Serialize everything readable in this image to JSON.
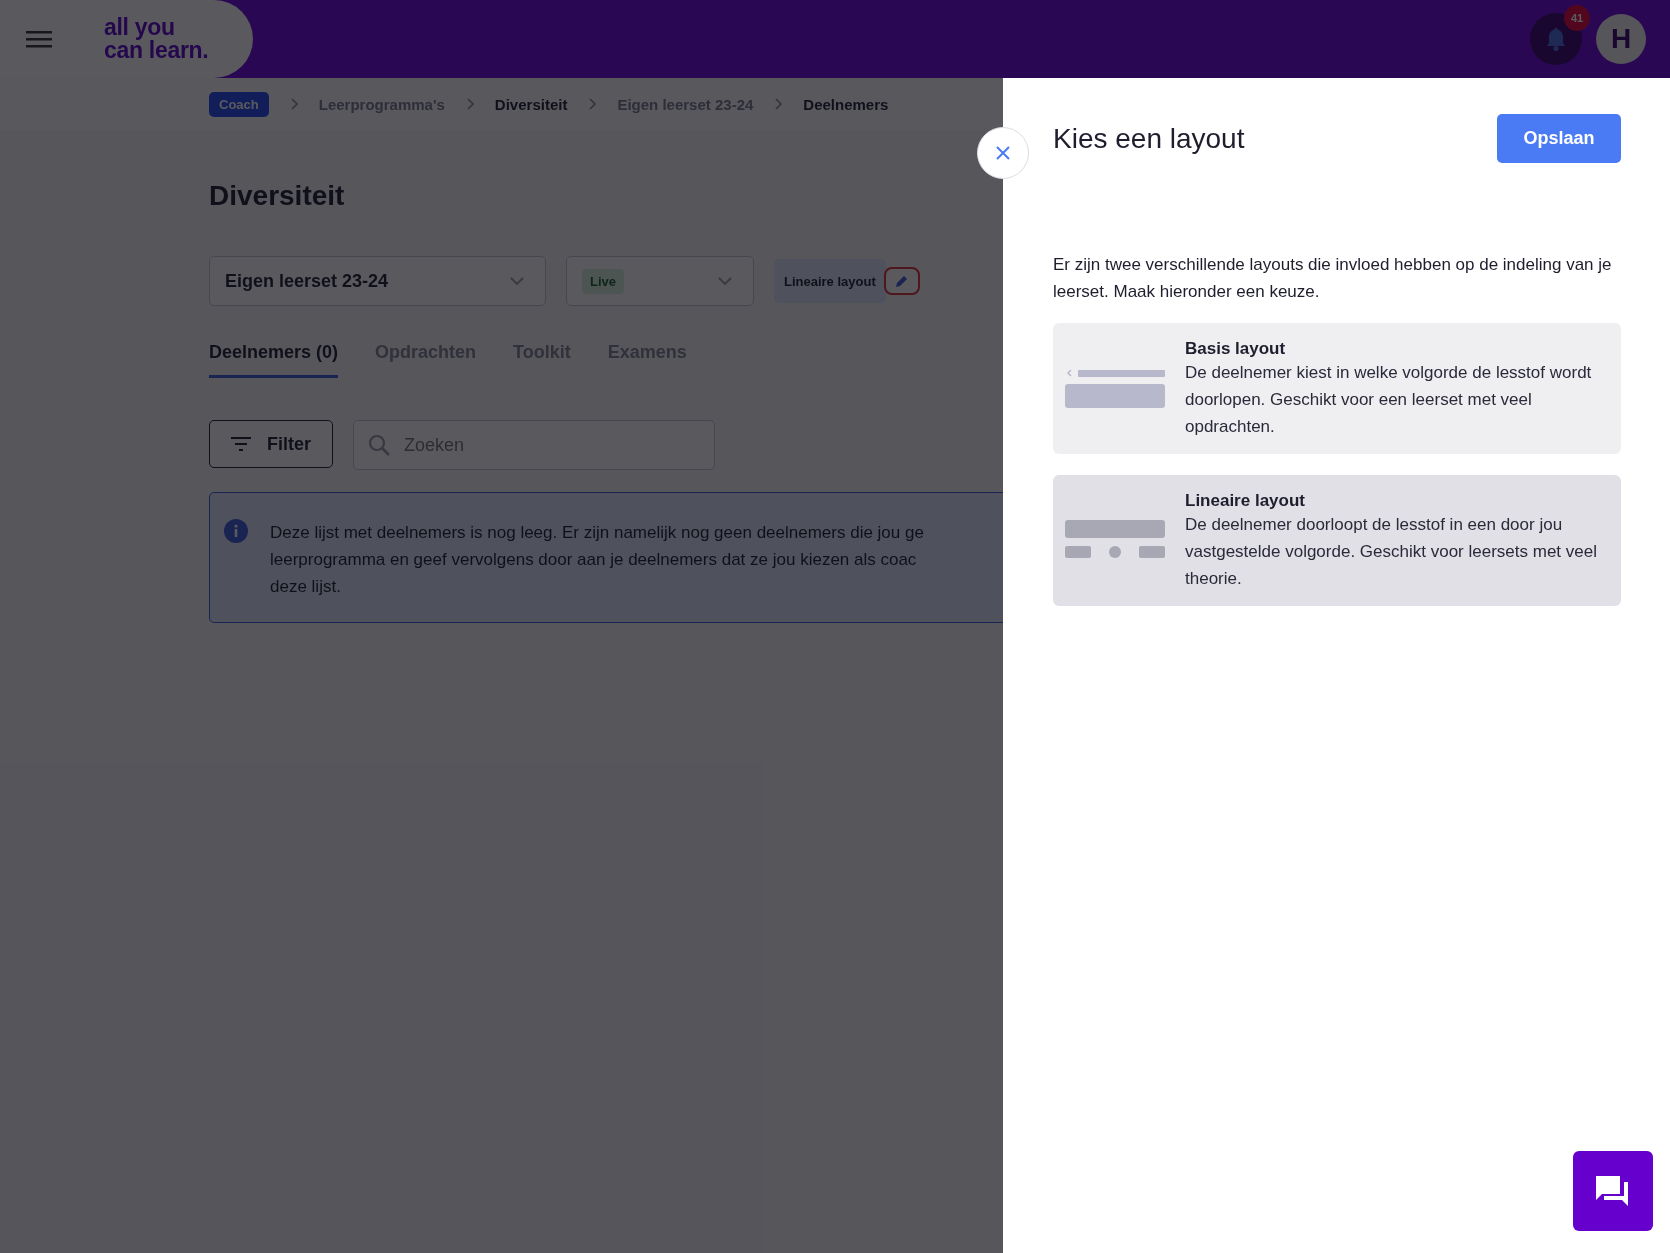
{
  "header": {
    "logo_lines": [
      "all you",
      "can learn."
    ],
    "notification_count": "41",
    "avatar_initial": "H"
  },
  "breadcrumb": [
    {
      "label": "Coach",
      "kind": "role"
    },
    {
      "label": "Leerprogramma's",
      "kind": "link"
    },
    {
      "label": "Diversiteit",
      "kind": "strong"
    },
    {
      "label": "Eigen leerset 23-24",
      "kind": "link"
    },
    {
      "label": "Deelnemers",
      "kind": "strong"
    }
  ],
  "page_title": "Diversiteit",
  "selects": [
    {
      "value": "Eigen leerset 23-24",
      "kind": "text"
    },
    {
      "value": "Live",
      "kind": "status"
    }
  ],
  "layout_badge": "Lineaire layout",
  "tabs": [
    {
      "label": "Deelnemers (0)",
      "selected": true
    },
    {
      "label": "Opdrachten",
      "selected": false
    },
    {
      "label": "Toolkit",
      "selected": false
    },
    {
      "label": "Examens",
      "selected": false
    }
  ],
  "filter_button": "Filter",
  "search": {
    "placeholder": "Zoeken"
  },
  "info_lines": [
    "Deze lijst met deelnemers is nog leeg. Er zijn namelijk nog geen deelnemers die jou ge",
    "leerprogramma en geef vervolgens door aan je deelnemers dat ze jou kiezen als coac",
    "deze lijst."
  ],
  "panel": {
    "title": "Kies een layout",
    "save_button": "Opslaan",
    "description": "Er zijn twee verschillende layouts die invloed hebben op de indeling van je leerset. Maak hieronder een keuze.",
    "options": [
      {
        "kind": "basis",
        "title": "Basis layout",
        "description": "De deelnemer kiest in welke volgorde de lesstof wordt doorlopen. Geschikt voor een leerset met veel opdrachten.",
        "selected": false
      },
      {
        "kind": "lineair",
        "title": "Lineaire layout",
        "description": "De deelnemer doorloopt de lesstof in een door jou vastgestelde volgorde. Geschikt voor leersets met veel theorie.",
        "selected": true
      }
    ]
  }
}
